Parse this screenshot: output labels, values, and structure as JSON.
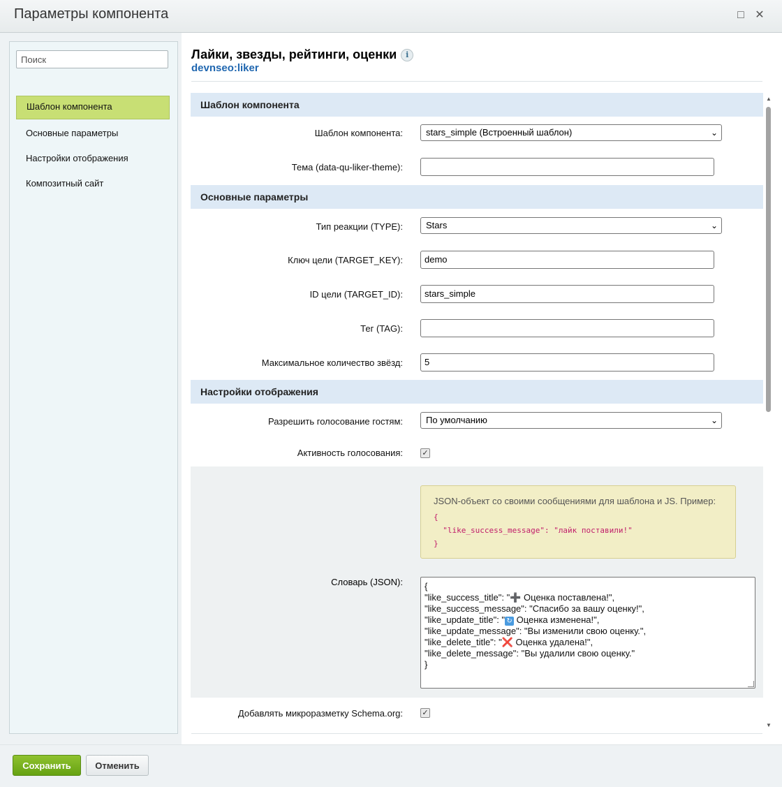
{
  "window": {
    "title": "Параметры компонента",
    "maximize_icon": "□",
    "close_icon": "✕"
  },
  "sidebar": {
    "search_placeholder": "Поиск",
    "items": [
      {
        "label": "Шаблон компонента",
        "active": true
      },
      {
        "label": "Основные параметры",
        "active": false
      },
      {
        "label": "Настройки отображения",
        "active": false
      },
      {
        "label": "Композитный сайт",
        "active": false
      }
    ]
  },
  "component": {
    "title": "Лайки, звезды, рейтинги, оценки",
    "code": "devnseo:liker",
    "info_icon": "i"
  },
  "sections": {
    "template": {
      "title": "Шаблон компонента",
      "template_label": "Шаблон компонента:",
      "template_value": "stars_simple (Встроенный шаблон)",
      "theme_label": "Тема (data-qu-liker-theme):",
      "theme_value": ""
    },
    "main": {
      "title": "Основные параметры",
      "type_label": "Тип реакции (TYPE):",
      "type_value": "Stars",
      "target_key_label": "Ключ цели (TARGET_KEY):",
      "target_key_value": "demo",
      "target_id_label": "ID цели (TARGET_ID):",
      "target_id_value": "stars_simple",
      "tag_label": "Тег (TAG):",
      "tag_value": "",
      "max_stars_label": "Максимальное количество звёзд:",
      "max_stars_value": "5"
    },
    "display": {
      "title": "Настройки отображения",
      "guest_label": "Разрешить голосование гостям:",
      "guest_value": "По умолчанию",
      "active_label": "Активность голосования:",
      "active_checked": true,
      "hint_text": "JSON-объект со своими сообщениями для шаблона и JS. Пример:",
      "hint_code_open": "{",
      "hint_code_line": "\"like_success_message\": \"лайк поставили!\"",
      "hint_code_close": "}",
      "dict_label": "Словарь (JSON):",
      "dict_lines": {
        "l0": "{",
        "l1_a": "\"like_success_title\": \"",
        "l1_b": " Оценка поставлена!\",",
        "l2": "\"like_success_message\": \"Спасибо за вашу оценку!\",",
        "l3_a": "\"like_update_title\": \"",
        "l3_b": " Оценка изменена!\",",
        "l4": "\"like_update_message\": \"Вы изменили свою оценку.\",",
        "l5_a": "\"like_delete_title\": \"",
        "l5_b": " Оценка удалена!\",",
        "l6": "\"like_delete_message\": \"Вы удалили свою оценку.\"",
        "l7": "}"
      },
      "emoji": {
        "plus": "➕",
        "update": "🔄",
        "delete": "❌"
      },
      "schema_label": "Добавлять микроразметку Schema.org:",
      "schema_checked": true
    }
  },
  "footer": {
    "save_label": "Сохранить",
    "cancel_label": "Отменить"
  },
  "colors": {
    "active_nav": "#c8df74",
    "section_header": "#dde9f5",
    "save_button": "#7bb41f",
    "link_blue": "#2067b0",
    "hint_bg": "#f2eec6"
  }
}
